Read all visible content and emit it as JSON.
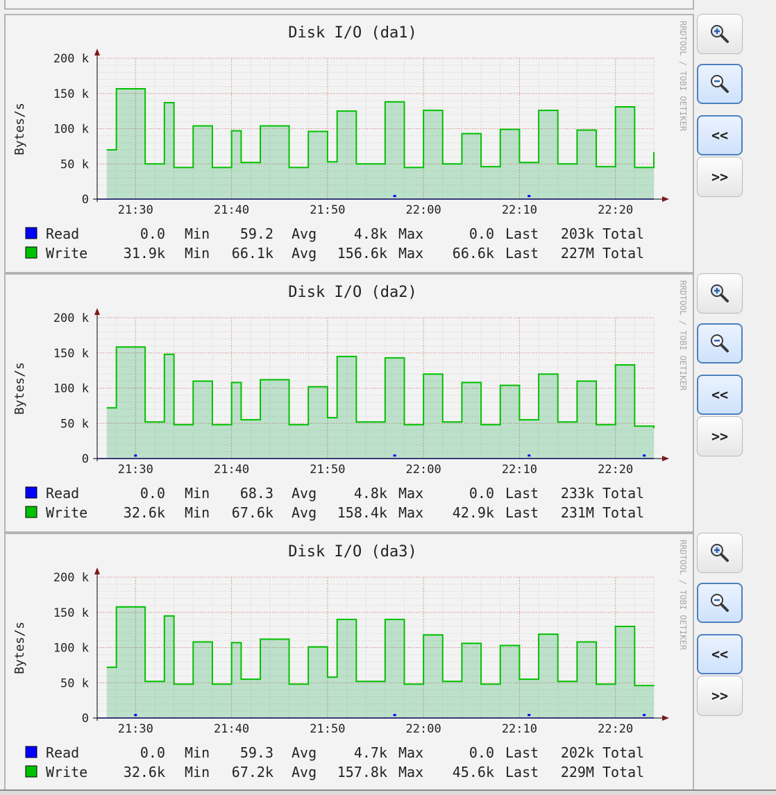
{
  "graphs": [
    {
      "title": "Disk I/O (da1)",
      "ylabel": "Bytes/s",
      "watermark": "RRDTOOL / TOBI OETIKER",
      "yticks": [
        "200 k",
        "150 k",
        "100 k",
        "50 k",
        "0"
      ],
      "xticks": [
        "21:30",
        "21:40",
        "21:50",
        "22:00",
        "22:10",
        "22:20"
      ],
      "legend": [
        {
          "name": "Read",
          "color": "#0000ff",
          "min": "0.0",
          "min_label": "Min",
          "avg": "59.2",
          "avg_label": "Avg",
          "max": "4.8k",
          "max_label": "Max",
          "last": "0.0",
          "last_label": "Last",
          "total": "203k",
          "total_label": "Total"
        },
        {
          "name": "Write",
          "color": "#00c000",
          "min": "31.9k",
          "min_label": "Min",
          "avg": "66.1k",
          "avg_label": "Avg",
          "max": "156.6k",
          "max_label": "Max",
          "last": "66.6k",
          "last_label": "Last",
          "total": "227M",
          "total_label": "Total"
        }
      ]
    },
    {
      "title": "Disk I/O (da2)",
      "ylabel": "Bytes/s",
      "watermark": "RRDTOOL / TOBI OETIKER",
      "yticks": [
        "200 k",
        "150 k",
        "100 k",
        "50 k",
        "0"
      ],
      "xticks": [
        "21:30",
        "21:40",
        "21:50",
        "22:00",
        "22:10",
        "22:20"
      ],
      "legend": [
        {
          "name": "Read",
          "color": "#0000ff",
          "min": "0.0",
          "min_label": "Min",
          "avg": "68.3",
          "avg_label": "Avg",
          "max": "4.8k",
          "max_label": "Max",
          "last": "0.0",
          "last_label": "Last",
          "total": "233k",
          "total_label": "Total"
        },
        {
          "name": "Write",
          "color": "#00c000",
          "min": "32.6k",
          "min_label": "Min",
          "avg": "67.6k",
          "avg_label": "Avg",
          "max": "158.4k",
          "max_label": "Max",
          "last": "42.9k",
          "last_label": "Last",
          "total": "231M",
          "total_label": "Total"
        }
      ]
    },
    {
      "title": "Disk I/O (da3)",
      "ylabel": "Bytes/s",
      "watermark": "RRDTOOL / TOBI OETIKER",
      "yticks": [
        "200 k",
        "150 k",
        "100 k",
        "50 k",
        "0"
      ],
      "xticks": [
        "21:30",
        "21:40",
        "21:50",
        "22:00",
        "22:10",
        "22:20"
      ],
      "legend": [
        {
          "name": "Read",
          "color": "#0000ff",
          "min": "0.0",
          "min_label": "Min",
          "avg": "59.3",
          "avg_label": "Avg",
          "max": "4.7k",
          "max_label": "Max",
          "last": "0.0",
          "last_label": "Last",
          "total": "202k",
          "total_label": "Total"
        },
        {
          "name": "Write",
          "color": "#00c000",
          "min": "32.6k",
          "min_label": "Min",
          "avg": "67.2k",
          "avg_label": "Avg",
          "max": "157.8k",
          "max_label": "Max",
          "last": "45.6k",
          "last_label": "Last",
          "total": "229M",
          "total_label": "Total"
        }
      ]
    }
  ],
  "controls": [
    {
      "zoom_in_icon": "magnifier-plus-icon",
      "zoom_out_icon": "magnifier-minus-icon",
      "prev_label": "<<",
      "next_label": ">>"
    },
    {
      "zoom_in_icon": "magnifier-plus-icon",
      "zoom_out_icon": "magnifier-minus-icon",
      "prev_label": "<<",
      "next_label": ">>"
    },
    {
      "zoom_in_icon": "magnifier-plus-icon",
      "zoom_out_icon": "magnifier-minus-icon",
      "prev_label": "<<",
      "next_label": ">>"
    }
  ],
  "chart_data": [
    {
      "type": "area",
      "title": "Disk I/O (da1)",
      "ylabel": "Bytes/s",
      "ylim": [
        0,
        200000
      ],
      "x_range": [
        "21:26",
        "22:24"
      ],
      "grid": true,
      "series": [
        {
          "name": "Read",
          "color": "#0000ff",
          "x": [
            "21:57",
            "22:11"
          ],
          "values": [
            4800,
            4800
          ]
        },
        {
          "name": "Write",
          "color": "#00c000",
          "x": [
            "21:27",
            "21:28",
            "21:31",
            "21:33",
            "21:34",
            "21:36",
            "21:38",
            "21:40",
            "21:41",
            "21:43",
            "21:46",
            "21:48",
            "21:50",
            "21:51",
            "21:53",
            "21:56",
            "21:58",
            "22:00",
            "22:02",
            "22:04",
            "22:06",
            "22:08",
            "22:10",
            "22:12",
            "22:14",
            "22:16",
            "22:18",
            "22:20",
            "22:22",
            "22:24"
          ],
          "values": [
            70000,
            156600,
            50000,
            137000,
            45000,
            104000,
            45000,
            97000,
            52000,
            104000,
            45000,
            96000,
            53000,
            125000,
            50000,
            138000,
            45000,
            126000,
            50000,
            93000,
            46000,
            99000,
            52000,
            126000,
            50000,
            98000,
            46000,
            131000,
            45000,
            66600
          ]
        }
      ]
    },
    {
      "type": "area",
      "title": "Disk I/O (da2)",
      "ylabel": "Bytes/s",
      "ylim": [
        0,
        200000
      ],
      "x_range": [
        "21:26",
        "22:24"
      ],
      "grid": true,
      "series": [
        {
          "name": "Read",
          "color": "#0000ff",
          "x": [
            "21:30",
            "21:57",
            "22:11",
            "22:23"
          ],
          "values": [
            4800,
            4800,
            4800,
            4800
          ]
        },
        {
          "name": "Write",
          "color": "#00c000",
          "x": [
            "21:27",
            "21:28",
            "21:31",
            "21:33",
            "21:34",
            "21:36",
            "21:38",
            "21:40",
            "21:41",
            "21:43",
            "21:46",
            "21:48",
            "21:50",
            "21:51",
            "21:53",
            "21:56",
            "21:58",
            "22:00",
            "22:02",
            "22:04",
            "22:06",
            "22:08",
            "22:10",
            "22:12",
            "22:14",
            "22:16",
            "22:18",
            "22:20",
            "22:22",
            "22:24"
          ],
          "values": [
            72000,
            158400,
            52000,
            148000,
            48000,
            110000,
            48000,
            108000,
            55000,
            112000,
            48000,
            102000,
            58000,
            145000,
            52000,
            143000,
            48000,
            120000,
            52000,
            108000,
            48000,
            104000,
            55000,
            120000,
            52000,
            110000,
            48000,
            133000,
            46000,
            42900
          ]
        }
      ]
    },
    {
      "type": "area",
      "title": "Disk I/O (da3)",
      "ylabel": "Bytes/s",
      "ylim": [
        0,
        200000
      ],
      "x_range": [
        "21:26",
        "22:24"
      ],
      "grid": true,
      "series": [
        {
          "name": "Read",
          "color": "#0000ff",
          "x": [
            "21:30",
            "21:57",
            "22:11",
            "22:23"
          ],
          "values": [
            4700,
            4700,
            4700,
            4700
          ]
        },
        {
          "name": "Write",
          "color": "#00c000",
          "x": [
            "21:27",
            "21:28",
            "21:31",
            "21:33",
            "21:34",
            "21:36",
            "21:38",
            "21:40",
            "21:41",
            "21:43",
            "21:46",
            "21:48",
            "21:50",
            "21:51",
            "21:53",
            "21:56",
            "21:58",
            "22:00",
            "22:02",
            "22:04",
            "22:06",
            "22:08",
            "22:10",
            "22:12",
            "22:14",
            "22:16",
            "22:18",
            "22:20",
            "22:22",
            "22:24"
          ],
          "values": [
            72000,
            157800,
            52000,
            145000,
            48000,
            108000,
            48000,
            107000,
            55000,
            112000,
            48000,
            101000,
            58000,
            140000,
            52000,
            140000,
            48000,
            118000,
            52000,
            106000,
            48000,
            103000,
            55000,
            119000,
            52000,
            108000,
            48000,
            130000,
            46000,
            45600
          ]
        }
      ]
    }
  ]
}
